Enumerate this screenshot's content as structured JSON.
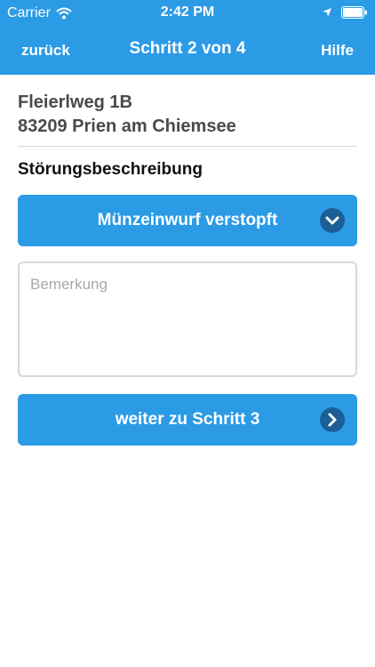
{
  "status_bar": {
    "carrier": "Carrier",
    "time": "2:42 PM"
  },
  "nav": {
    "back_label": "zurück",
    "title": "Schritt 2 von 4",
    "help_label": "Hilfe"
  },
  "address": {
    "street": "Fleierlweg 1B",
    "city": "83209 Prien am Chiemsee"
  },
  "section_title": "Störungsbeschreibung",
  "fault_select": {
    "selected": "Münzeinwurf verstopft",
    "icon": "chevron-down-icon"
  },
  "remark": {
    "placeholder": "Bemerkung",
    "value": ""
  },
  "next_button": {
    "label": "weiter zu Schritt 3",
    "icon": "chevron-right-icon"
  },
  "colors": {
    "primary": "#2b9be6",
    "icon_circle": "#1c5f96",
    "text_dark": "#4a4a4a"
  }
}
